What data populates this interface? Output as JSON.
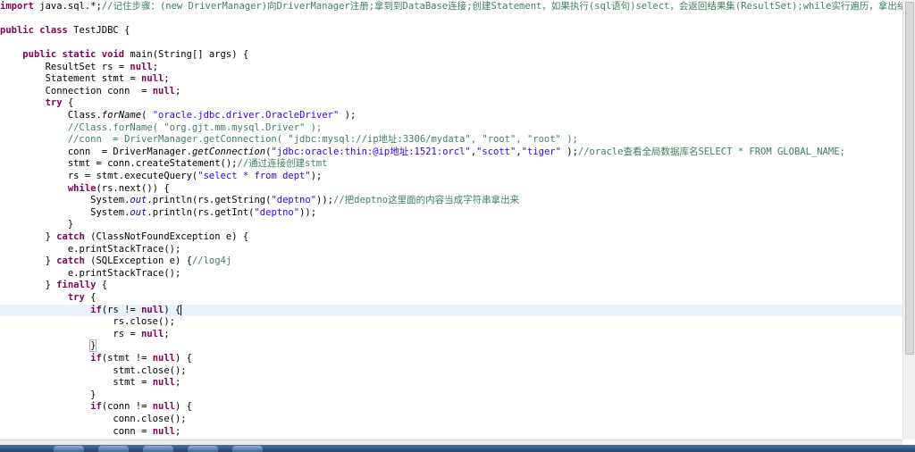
{
  "editor": {
    "lines": [
      {
        "current": false,
        "tokens": [
          [
            "kw",
            "import"
          ],
          [
            "plain",
            " java.sql.*;"
          ],
          [
            "cm",
            "//记住步骤：(new DriverManager)向DriverManager注册;拿到到DataBase连接;创建Statement，如果执行(sql语句)select，会返回结果集(ResultSet);while实行遍历，拿出结果集"
          ]
        ]
      },
      {
        "current": false,
        "tokens": []
      },
      {
        "current": false,
        "tokens": [
          [
            "kw",
            "public class"
          ],
          [
            "plain",
            " TestJDBC {"
          ]
        ]
      },
      {
        "current": false,
        "tokens": []
      },
      {
        "current": false,
        "tokens": [
          [
            "plain",
            "    "
          ],
          [
            "kw",
            "public static void"
          ],
          [
            "plain",
            " main(String[] args) {"
          ]
        ]
      },
      {
        "current": false,
        "tokens": [
          [
            "plain",
            "        ResultSet rs = "
          ],
          [
            "kw",
            "null"
          ],
          [
            "plain",
            ";"
          ]
        ]
      },
      {
        "current": false,
        "tokens": [
          [
            "plain",
            "        Statement stmt = "
          ],
          [
            "kw",
            "null"
          ],
          [
            "plain",
            ";"
          ]
        ]
      },
      {
        "current": false,
        "tokens": [
          [
            "plain",
            "        Connection conn  = "
          ],
          [
            "kw",
            "null"
          ],
          [
            "plain",
            ";"
          ]
        ]
      },
      {
        "current": false,
        "tokens": [
          [
            "plain",
            "        "
          ],
          [
            "kw",
            "try"
          ],
          [
            "plain",
            " {"
          ]
        ]
      },
      {
        "current": false,
        "tokens": [
          [
            "plain",
            "            Class."
          ],
          [
            "it",
            "forName"
          ],
          [
            "plain",
            "( "
          ],
          [
            "str",
            "\"oracle.jdbc.driver.OracleDriver\""
          ],
          [
            "plain",
            " );"
          ]
        ]
      },
      {
        "current": false,
        "tokens": [
          [
            "plain",
            "            "
          ],
          [
            "cm",
            "//Class.forName( \"org.gjt.mm.mysql.Driver\" );"
          ]
        ]
      },
      {
        "current": false,
        "tokens": [
          [
            "plain",
            "            "
          ],
          [
            "cm",
            "//conn  = DriverManager.getConnection( \"jdbc:mysql://ip地址:3306/mydata\", \"root\", \"root\" );"
          ]
        ]
      },
      {
        "current": false,
        "tokens": [
          [
            "plain",
            "            conn  = DriverManager."
          ],
          [
            "it",
            "getConnection"
          ],
          [
            "plain",
            "("
          ],
          [
            "str",
            "\"jdbc:oracle:thin:@ip地址:1521:orcl\""
          ],
          [
            "plain",
            ","
          ],
          [
            "str",
            "\"scott\""
          ],
          [
            "plain",
            ","
          ],
          [
            "str",
            "\"tiger\""
          ],
          [
            "plain",
            " );"
          ],
          [
            "cm",
            "//oracle查看全局数据库名SELECT * FROM GLOBAL_NAME;"
          ]
        ]
      },
      {
        "current": false,
        "tokens": [
          [
            "plain",
            "            stmt = conn.createStatement();"
          ],
          [
            "cm",
            "//通过连接创建stmt"
          ]
        ]
      },
      {
        "current": false,
        "tokens": [
          [
            "plain",
            "            rs = stmt.executeQuery("
          ],
          [
            "str",
            "\"select * from dept\""
          ],
          [
            "plain",
            ");"
          ]
        ]
      },
      {
        "current": false,
        "tokens": [
          [
            "plain",
            "            "
          ],
          [
            "kw",
            "while"
          ],
          [
            "plain",
            "(rs.next()) {"
          ]
        ]
      },
      {
        "current": false,
        "tokens": [
          [
            "plain",
            "                System."
          ],
          [
            "fld",
            "out"
          ],
          [
            "plain",
            ".println(rs.getString("
          ],
          [
            "str",
            "\"deptno\""
          ],
          [
            "plain",
            "));"
          ],
          [
            "cm",
            "//把deptno这里面的内容当成字符串拿出来"
          ]
        ]
      },
      {
        "current": false,
        "tokens": [
          [
            "plain",
            "                System."
          ],
          [
            "fld",
            "out"
          ],
          [
            "plain",
            ".println(rs.getInt("
          ],
          [
            "str",
            "\"deptno\""
          ],
          [
            "plain",
            "));"
          ]
        ]
      },
      {
        "current": false,
        "tokens": [
          [
            "plain",
            "            }"
          ]
        ]
      },
      {
        "current": false,
        "tokens": [
          [
            "plain",
            "        } "
          ],
          [
            "kw",
            "catch"
          ],
          [
            "plain",
            " (ClassNotFoundException e) {"
          ]
        ]
      },
      {
        "current": false,
        "tokens": [
          [
            "plain",
            "            e.printStackTrace();"
          ]
        ]
      },
      {
        "current": false,
        "tokens": [
          [
            "plain",
            "        } "
          ],
          [
            "kw",
            "catch"
          ],
          [
            "plain",
            " (SQLException e) {"
          ],
          [
            "cm",
            "//log4j"
          ]
        ]
      },
      {
        "current": false,
        "tokens": [
          [
            "plain",
            "            e.printStackTrace();"
          ]
        ]
      },
      {
        "current": false,
        "tokens": [
          [
            "plain",
            "        } "
          ],
          [
            "kw",
            "finally"
          ],
          [
            "plain",
            " {"
          ]
        ]
      },
      {
        "current": false,
        "tokens": [
          [
            "plain",
            "            "
          ],
          [
            "kw",
            "try"
          ],
          [
            "plain",
            " {"
          ]
        ]
      },
      {
        "current": true,
        "tokens": [
          [
            "plain",
            "                "
          ],
          [
            "kw",
            "if"
          ],
          [
            "plain",
            "(rs != "
          ],
          [
            "kw",
            "null"
          ],
          [
            "plain",
            ") {"
          ]
        ]
      },
      {
        "current": false,
        "tokens": [
          [
            "plain",
            "                    rs.close();"
          ]
        ]
      },
      {
        "current": false,
        "tokens": [
          [
            "plain",
            "                    rs = "
          ],
          [
            "kw",
            "null"
          ],
          [
            "plain",
            ";"
          ]
        ]
      },
      {
        "current": false,
        "tokens": [
          [
            "plain",
            "                "
          ],
          [
            "br",
            "}"
          ]
        ]
      },
      {
        "current": false,
        "tokens": [
          [
            "plain",
            "                "
          ],
          [
            "kw",
            "if"
          ],
          [
            "plain",
            "(stmt != "
          ],
          [
            "kw",
            "null"
          ],
          [
            "plain",
            ") {"
          ]
        ]
      },
      {
        "current": false,
        "tokens": [
          [
            "plain",
            "                    stmt.close();"
          ]
        ]
      },
      {
        "current": false,
        "tokens": [
          [
            "plain",
            "                    stmt = "
          ],
          [
            "kw",
            "null"
          ],
          [
            "plain",
            ";"
          ]
        ]
      },
      {
        "current": false,
        "tokens": [
          [
            "plain",
            "                }"
          ]
        ]
      },
      {
        "current": false,
        "tokens": [
          [
            "plain",
            "                "
          ],
          [
            "kw",
            "if"
          ],
          [
            "plain",
            "(conn != "
          ],
          [
            "kw",
            "null"
          ],
          [
            "plain",
            ") {"
          ]
        ]
      },
      {
        "current": false,
        "tokens": [
          [
            "plain",
            "                    conn.close();"
          ]
        ]
      },
      {
        "current": false,
        "tokens": [
          [
            "plain",
            "                    conn = "
          ],
          [
            "kw",
            "null"
          ],
          [
            "plain",
            ";"
          ]
        ]
      }
    ]
  },
  "colors": {
    "keyword": "#7f0055",
    "string": "#2a00ff",
    "comment": "#3f7f5f",
    "field": "#0000c0",
    "current_line": "#e8f2fe"
  }
}
